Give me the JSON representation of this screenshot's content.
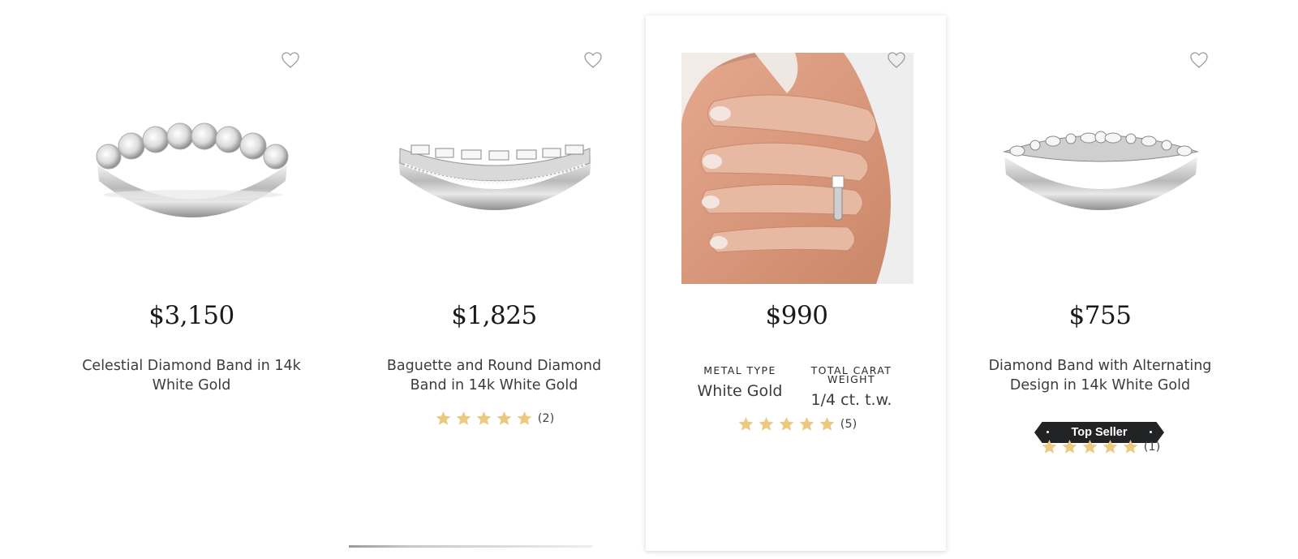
{
  "products": [
    {
      "price": "$3,150",
      "name": "Celestial Diamond Band in 14k White Gold",
      "image": "ring-band-round-diamonds"
    },
    {
      "price": "$1,825",
      "name": "Baguette and Round Diamond Band in 14k White Gold",
      "image": "ring-band-baguette-diamonds",
      "rating": 5,
      "review_count": "(2)"
    },
    {
      "price": "$990",
      "image": "hand-wearing-ring-photo",
      "specs": [
        {
          "label": "METAL TYPE",
          "value": "White Gold"
        },
        {
          "label": "TOTAL CARAT WEIGHT",
          "value": "1/4 ct. t.w."
        }
      ],
      "rating": 5,
      "review_count": "(5)"
    },
    {
      "price": "$755",
      "name": "Diamond Band with Alternating Design in 14k White Gold",
      "image": "ring-band-alternating-design",
      "badge": "Top Seller",
      "rating": 5,
      "review_count": "(1)"
    }
  ],
  "icons": {
    "favorite": "heart-outline-icon",
    "rating": "star-icon"
  },
  "colors": {
    "star": "#ecc97f",
    "badge_bg": "#222325",
    "price": "#1a1a1a"
  }
}
